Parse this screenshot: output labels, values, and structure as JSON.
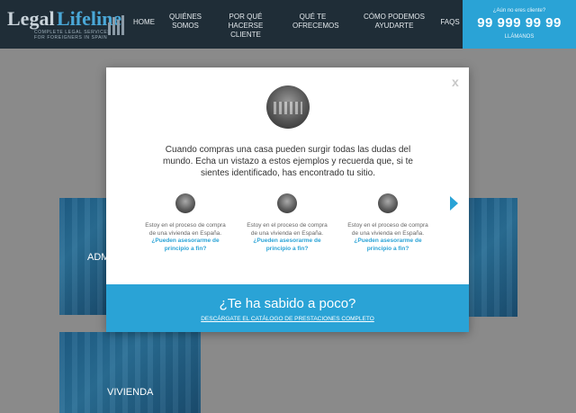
{
  "header": {
    "logo": {
      "word1": "Legal",
      "word2": "Lifeline",
      "tagline1": "COMPLETE LEGAL SERVICES",
      "tagline2": "FOR FOREIGNERS IN SPAIN"
    },
    "nav": [
      {
        "label": "HOME",
        "lines": [
          "HOME"
        ]
      },
      {
        "label": "QUIÉNES SOMOS",
        "lines": [
          "QUIÉNES",
          "SOMOS"
        ]
      },
      {
        "label": "POR QUÉ HACERSE CLIENTE",
        "lines": [
          "POR QUÉ HACERSE",
          "CLIENTE"
        ]
      },
      {
        "label": "QUÉ TE OFRECEMOS",
        "lines": [
          "QUÉ TE",
          "OFRECEMOS"
        ]
      },
      {
        "label": "CÓMO PODEMOS AYUDARTE",
        "lines": [
          "CÓMO PODEMOS",
          "AYUDARTE"
        ]
      },
      {
        "label": "FAQS",
        "lines": [
          "FAQS"
        ]
      }
    ],
    "call": {
      "question": "¿Aún no eres cliente?",
      "phone": "99 999 99 99",
      "cta": "LLÁMANOS"
    }
  },
  "background": {
    "tile_left_label": "ADM",
    "tile_bottom_label": "VIVIENDA"
  },
  "modal": {
    "close_label": "x",
    "intro": "Cuando compras una casa pueden surgir todas las dudas del mundo. Echa un vistazo a estos ejemplos y recuerda que, si te sientes identificado, has encontrado tu sitio.",
    "cards": [
      {
        "text": "Estoy en el proceso de compra de una vivienda en España.",
        "link": "¿Pueden asesorarme de principio a fin?"
      },
      {
        "text": "Estoy en el proceso de compra de una vivienda en España.",
        "link": "¿Pueden asesorarme de principio a fin?"
      },
      {
        "text": "Estoy en el proceso de compra de una vivienda en España.",
        "link": "¿Pueden asesorarme de principio a fin?"
      }
    ],
    "footer": {
      "title": "¿Te ha sabido a poco?",
      "link": "DESCÁRGATE EL CATÁLOGO DE PRESTACIONES COMPLETO"
    }
  },
  "colors": {
    "header_bg": "#1f2d37",
    "accent": "#2aa3d6",
    "overlay": "#8a8a8a"
  }
}
